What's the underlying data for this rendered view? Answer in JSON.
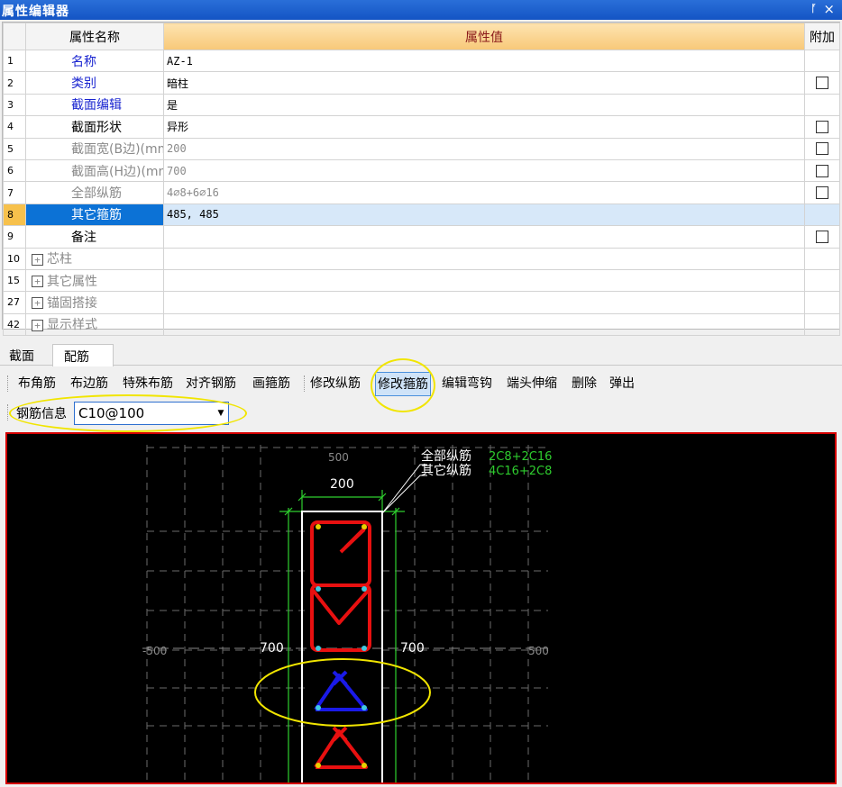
{
  "window": {
    "title": "属性编辑器",
    "pin_glyph": "ᚪ",
    "close_glyph": "×"
  },
  "grid": {
    "headers": {
      "name": "属性名称",
      "value": "属性值",
      "add": "附加"
    },
    "rows": [
      {
        "num": "1",
        "name": "名称",
        "value": "AZ-1",
        "color": "blue",
        "checkbox": false
      },
      {
        "num": "2",
        "name": "类别",
        "value": "暗柱",
        "color": "blue",
        "checkbox": true
      },
      {
        "num": "3",
        "name": "截面编辑",
        "value": "是",
        "color": "blue",
        "checkbox": false
      },
      {
        "num": "4",
        "name": "截面形状",
        "value": "异形",
        "color": "black",
        "checkbox": true
      },
      {
        "num": "5",
        "name": "截面宽(B边)(mm)",
        "value": "200",
        "color": "gray",
        "checkbox": true
      },
      {
        "num": "6",
        "name": "截面高(H边)(mm)",
        "value": "700",
        "color": "gray",
        "checkbox": true
      },
      {
        "num": "7",
        "name": "全部纵筋",
        "value": "4⌀8+6⌀16",
        "color": "gray",
        "checkbox": true
      },
      {
        "num": "8",
        "name": "其它箍筋",
        "value": "485, 485",
        "color": "selected",
        "checkbox": false
      },
      {
        "num": "9",
        "name": "备注",
        "value": "",
        "color": "black",
        "checkbox": true
      }
    ],
    "groups": [
      {
        "num": "10",
        "name": "芯柱"
      },
      {
        "num": "15",
        "name": "其它属性"
      },
      {
        "num": "27",
        "name": "锚固搭接"
      },
      {
        "num": "42",
        "name": "显示样式"
      }
    ],
    "expander_glyph": "+"
  },
  "tabs": [
    {
      "label": "截面"
    },
    {
      "label": "配筋"
    }
  ],
  "toolbar": {
    "items": [
      "布角筋",
      "布边筋",
      "特殊布筋",
      "对齐钢筋",
      "画箍筋",
      "修改纵筋",
      "修改箍筋",
      "编辑弯钩",
      "端头伸缩",
      "删除",
      "弹出"
    ],
    "active": "修改箍筋"
  },
  "rebar_info": {
    "label": "钢筋信息",
    "value": "C10@100",
    "arrow": "▼"
  },
  "canvas": {
    "width_dim": "200",
    "height_dim_left": "700",
    "height_dim_right": "700",
    "axis_top": "500",
    "axis_left": "-500",
    "axis_right": "500",
    "legend": [
      {
        "label": "全部纵筋",
        "value": "2C8+2C16"
      },
      {
        "label": "其它纵筋",
        "value": "4C16+2C8"
      }
    ],
    "colors": {
      "stirrup": "#e81010",
      "active_stirrup": "#1a1ae8",
      "dim": "#2fd02f",
      "outline": "#ffffff",
      "highlight": "#f1e500",
      "bar_dot": "#e8d000",
      "bar_dot2": "#40c8e0"
    }
  }
}
